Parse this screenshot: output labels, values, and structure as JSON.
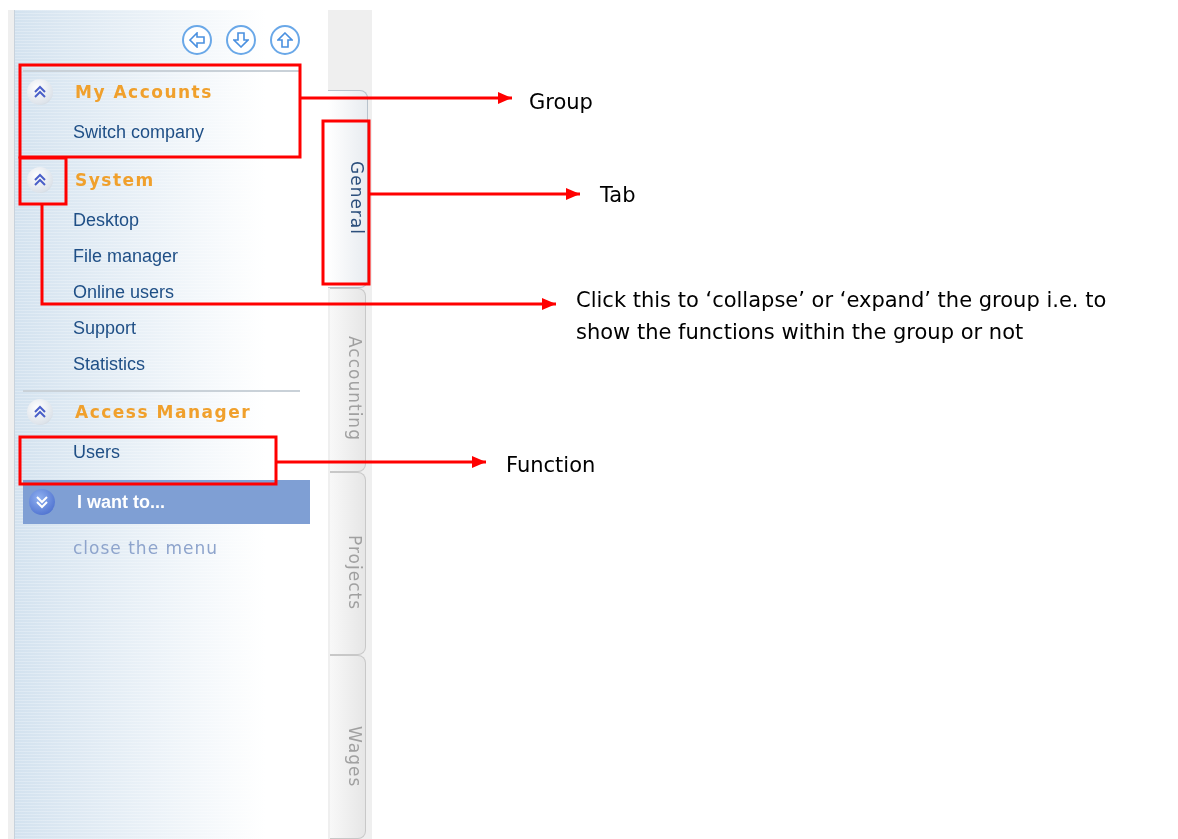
{
  "sidebar": {
    "nav_buttons": [
      {
        "kind": "left"
      },
      {
        "kind": "down"
      },
      {
        "kind": "up"
      }
    ],
    "groups": [
      {
        "title": "My Accounts",
        "expanded": true,
        "divider_above": true,
        "items": [
          "Switch company"
        ]
      },
      {
        "title": "System",
        "expanded": true,
        "divider_above": false,
        "items": [
          "Desktop",
          "File manager",
          "Online users",
          "Support",
          "Statistics"
        ]
      },
      {
        "title": "Access Manager",
        "expanded": true,
        "divider_above": true,
        "items": [
          "Users"
        ]
      }
    ],
    "action_panel": {
      "title": "I want to...",
      "items": [
        "close the menu"
      ]
    }
  },
  "tabs": [
    {
      "label": "General",
      "selected": true
    },
    {
      "label": "Accounting",
      "selected": false
    },
    {
      "label": "Projects",
      "selected": false
    },
    {
      "label": "Wages",
      "selected": false
    }
  ],
  "annotations": [
    {
      "label": "Group"
    },
    {
      "label": "Tab"
    },
    {
      "label": "Click this to ‘collapse’ or ‘expand’ the group i.e. to show the functions within the group or not"
    },
    {
      "label": "Function"
    }
  ]
}
